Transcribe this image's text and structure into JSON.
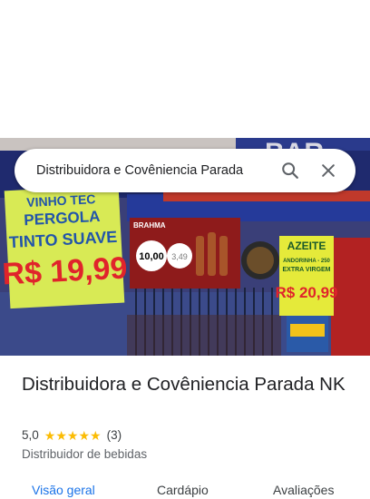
{
  "search": {
    "query": "Distribuidora e Covêniencia Parada",
    "search_icon": "search-icon",
    "close_icon": "close-icon"
  },
  "photo": {
    "signs": {
      "pergola_line1": "VINHO TEC",
      "pergola_line2": "PERGOLA",
      "pergola_line3": "TINTO SUAVE",
      "pergola_price": "R$ 19,99",
      "brahma": "BRAHMA",
      "brahma_price1": "10,00",
      "brahma_price2": "3,49",
      "azeite_title": "AZEITE",
      "azeite_line2": "ANDORINHA - 250",
      "azeite_line3": "EXTRA VIRGEM",
      "azeite_price": "R$ 20,99",
      "store_letters": "BAR"
    }
  },
  "place": {
    "name": "Distribuidora e Covêniencia Parada NK",
    "rating": "5,0",
    "review_count": "(3)",
    "star_count": 5,
    "category": "Distribuidor de bebidas",
    "colors": {
      "star": "#fbbc04",
      "active_tab": "#1a73e8"
    }
  },
  "tabs": [
    {
      "label": "Visão geral",
      "active": true
    },
    {
      "label": "Cardápio",
      "active": false
    },
    {
      "label": "Avaliações",
      "active": false
    }
  ]
}
